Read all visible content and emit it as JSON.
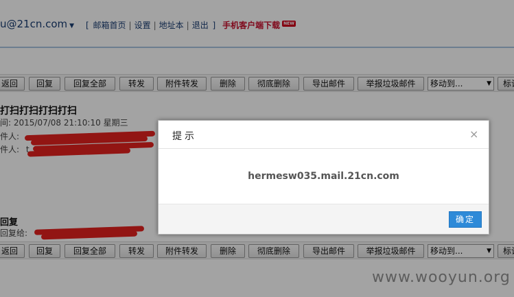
{
  "header": {
    "account": "u@21cn.com",
    "nav_bracket_open": "[",
    "nav_items": [
      "邮箱首页",
      "设置",
      "地址本",
      "退出"
    ],
    "nav_separator": "|",
    "nav_bracket_close": "]",
    "mobile_download": "手机客户端下载",
    "new_badge": "NEW"
  },
  "toolbar": {
    "back": "返回",
    "reply": "回复",
    "reply_all": "回复全部",
    "forward": "转发",
    "forward_attachment": "附件转发",
    "delete": "删除",
    "delete_permanent": "彻底删除",
    "export": "导出邮件",
    "report_spam": "举报垃圾邮件",
    "move_to": "移动到...",
    "mark": "标记"
  },
  "mail": {
    "subject": "打扫打扫打扫打扫",
    "time_label": "间:",
    "time_value": "2015/07/08 21:10:10 星期三",
    "from_label": "件人:",
    "to_label": "件人:",
    "to_visible_prefix": "t",
    "reply_title": "回复",
    "reply_to_label": "回复给:"
  },
  "dialog": {
    "title": "提示",
    "close_glyph": "×",
    "message": "hermesw035.mail.21cn.com",
    "ok_label": "确定"
  },
  "watermark": "www.wooyun.org",
  "colors": {
    "overlay": "rgba(0,0,0,0.36)",
    "primary_button": "#2e8ad8",
    "mobile_link": "#c8102e",
    "new_badge": "#d0021b",
    "redaction": "#e4221f"
  }
}
